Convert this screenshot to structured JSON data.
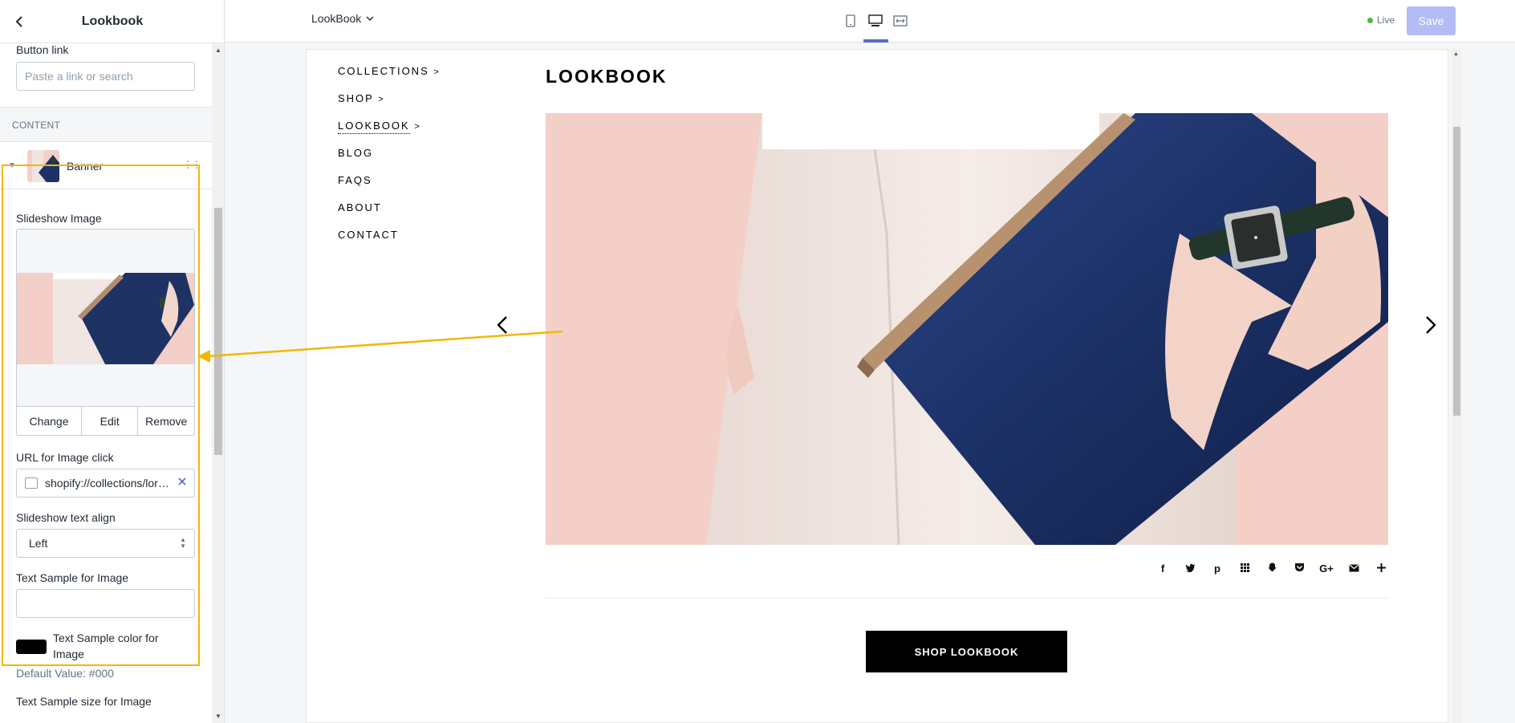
{
  "sidebar": {
    "title": "Lookbook",
    "button_link": {
      "label": "Button link",
      "placeholder": "Paste a link or search"
    },
    "section": "CONTENT",
    "block": {
      "label": "Banner"
    },
    "slideshow_image": {
      "label": "Slideshow Image",
      "actions": [
        "Change",
        "Edit",
        "Remove"
      ]
    },
    "url_image_click": {
      "label": "URL for Image click",
      "value": "shopify://collections/lorem-ipsum"
    },
    "text_align": {
      "label": "Slideshow text align",
      "value": "Left"
    },
    "text_sample": {
      "label": "Text Sample for Image",
      "value": ""
    },
    "text_color": {
      "label": "Text Sample color for Image",
      "helper": "Default Value: #000",
      "swatch": "#000000"
    },
    "text_size": {
      "label": "Text Sample size for Image"
    }
  },
  "topbar": {
    "page": "LookBook",
    "live": "Live",
    "save": "Save"
  },
  "preview": {
    "nav": [
      {
        "label": "COLLECTIONS",
        "arrow": ">"
      },
      {
        "label": "SHOP",
        "arrow": ">"
      },
      {
        "label": "LOOKBOOK",
        "arrow": ">"
      },
      {
        "label": "BLOG",
        "arrow": ""
      },
      {
        "label": "FAQS",
        "arrow": ""
      },
      {
        "label": "ABOUT",
        "arrow": ""
      },
      {
        "label": "CONTACT",
        "arrow": ""
      }
    ],
    "heading": "LOOKBOOK",
    "cta": "SHOP LOOKBOOK"
  },
  "colors": {
    "accent": "#5c6ac4",
    "highlight": "#f2b705",
    "live": "#50b83c",
    "save_disabled": "#b3bcf5"
  },
  "icons": {
    "device": [
      "mobile-icon",
      "desktop-icon",
      "full-width-icon"
    ],
    "share": [
      "facebook-icon",
      "twitter-icon",
      "pinterest-icon",
      "grid-icon",
      "snapchat-icon",
      "pocket-icon",
      "google-plus-icon",
      "email-icon",
      "plus-icon"
    ]
  }
}
